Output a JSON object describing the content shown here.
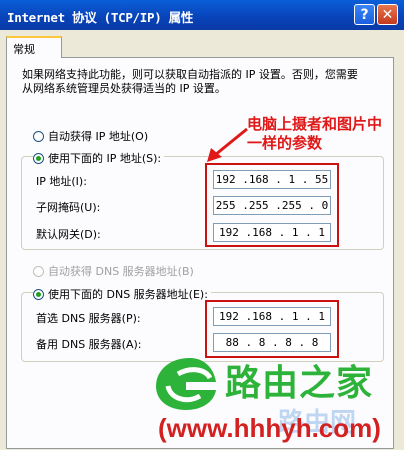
{
  "window": {
    "title": "Internet 协议 (TCP/IP) 属性",
    "help_label": "?",
    "close_label": "✕"
  },
  "tab": {
    "label": "常规"
  },
  "description": "如果网络支持此功能，则可以获取自动指派的 IP 设置。否则，您需要从网络系统管理员处获得适当的 IP 设置。",
  "ip": {
    "auto_label": "自动获得 IP 地址(O)",
    "manual_label": "使用下面的 IP 地址(S):",
    "address_label": "IP 地址(I):",
    "address_value": "192 .168 . 1  . 55",
    "mask_label": "子网掩码(U):",
    "mask_value": "255 .255 .255 . 0",
    "gateway_label": "默认网关(D):",
    "gateway_value": "192 .168 . 1  . 1"
  },
  "dns": {
    "auto_label": "自动获得 DNS 服务器地址(B)",
    "manual_label": "使用下面的 DNS 服务器地址(E):",
    "preferred_label": "首选 DNS 服务器(P):",
    "preferred_value": "192 .168 . 1  . 1",
    "alternate_label": "备用 DNS 服务器(A):",
    "alternate_value": "88 . 8  . 8  . 8"
  },
  "annotation": {
    "line1": "电脑上摄者和图片中",
    "line2": "一样的参数"
  },
  "watermark": {
    "brand": "路由之家",
    "url": "(www.hhhyh.com)",
    "faint": "路由网"
  },
  "colors": {
    "annotation": "#e01818",
    "highlight_box": "#cc1111",
    "watermark_green": "#2db33a",
    "watermark_red": "#d32020"
  }
}
